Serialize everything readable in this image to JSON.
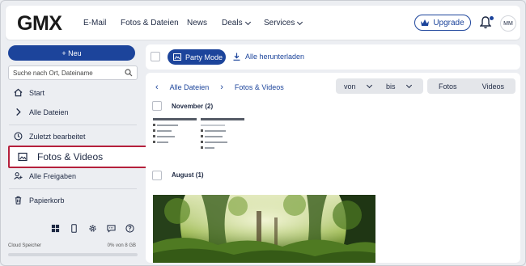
{
  "header": {
    "logo": "GMX",
    "nav": [
      {
        "label": "E-Mail"
      },
      {
        "label": "Fotos & Dateien"
      },
      {
        "label": "News"
      },
      {
        "label": "Deals"
      },
      {
        "label": "Services"
      }
    ],
    "upgrade_label": "Upgrade",
    "avatar_initials": "MM"
  },
  "sidebar": {
    "new_button": "+ Neu",
    "search_placeholder": "Suche nach Ort, Dateiname",
    "items": [
      {
        "label": "Start",
        "icon": "home-icon"
      },
      {
        "label": "Alle Dateien",
        "icon": "chevron-right-icon"
      },
      {
        "label": "Zuletzt bearbeitet",
        "icon": "clock-icon"
      },
      {
        "label": "Fotos & Videos",
        "icon": "image-icon",
        "active": true
      },
      {
        "label": "Alle Freigaben",
        "icon": "share-users-icon"
      },
      {
        "label": "Papierkorb",
        "icon": "trash-icon"
      }
    ],
    "footer_icons": [
      "windows-icon",
      "mobile-icon",
      "settings-icon",
      "chat-icon",
      "help-icon"
    ],
    "storage": {
      "label": "Cloud Speicher",
      "value": "0% von 8 GB",
      "used_fraction": 0.0
    }
  },
  "toolbar": {
    "party_mode": "Party Mode",
    "download_all": "Alle herunterladen"
  },
  "content": {
    "breadcrumb": [
      "Alle Dateien",
      "Fotos & Videos"
    ],
    "filter_from": "von",
    "filter_to": "bis",
    "type_photos": "Fotos",
    "type_videos": "Videos",
    "groups": [
      {
        "label": "November (2)"
      },
      {
        "label": "August (1)"
      }
    ]
  },
  "colors": {
    "brand": "#1c449b",
    "highlight": "#b5203c",
    "background": "#eceef2"
  }
}
